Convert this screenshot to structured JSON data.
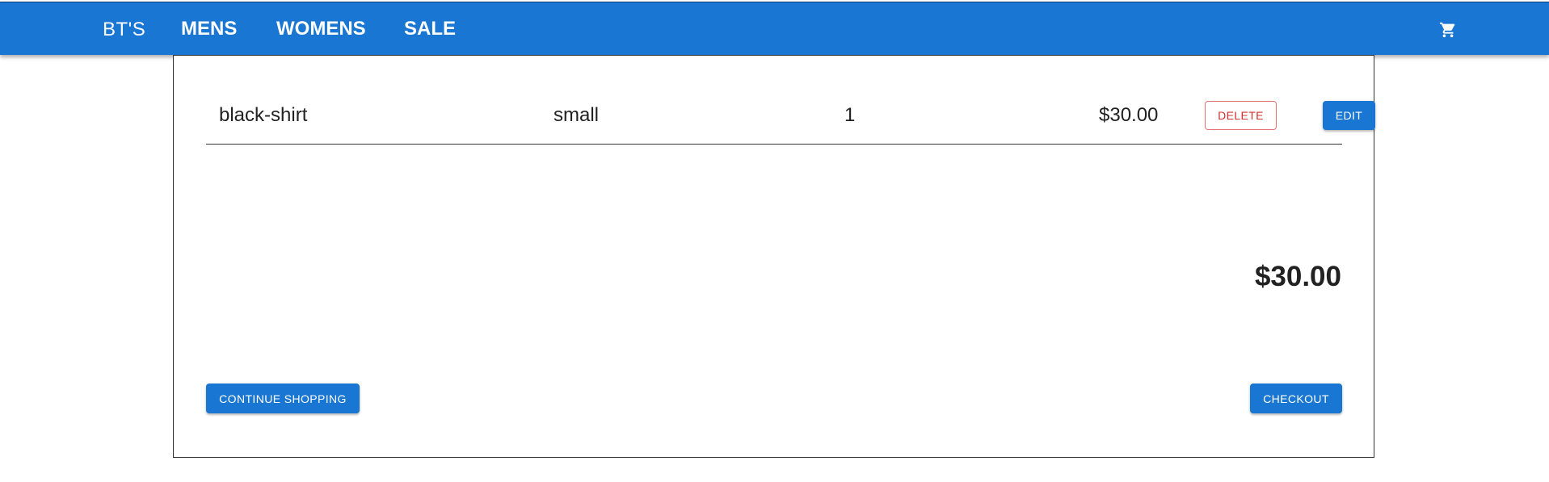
{
  "header": {
    "brand": "BT'S",
    "nav": [
      "MENS",
      "WOMENS",
      "SALE"
    ],
    "cart_icon": "shopping-cart-icon",
    "color": "#1976d2"
  },
  "cart": {
    "items": [
      {
        "name": "black-shirt",
        "size": "small",
        "quantity": "1",
        "price": "$30.00",
        "delete_label": "DELETE",
        "edit_label": "EDIT"
      }
    ],
    "total": "$30.00",
    "continue_label": "CONTINUE SHOPPING",
    "checkout_label": "CHECKOUT"
  }
}
